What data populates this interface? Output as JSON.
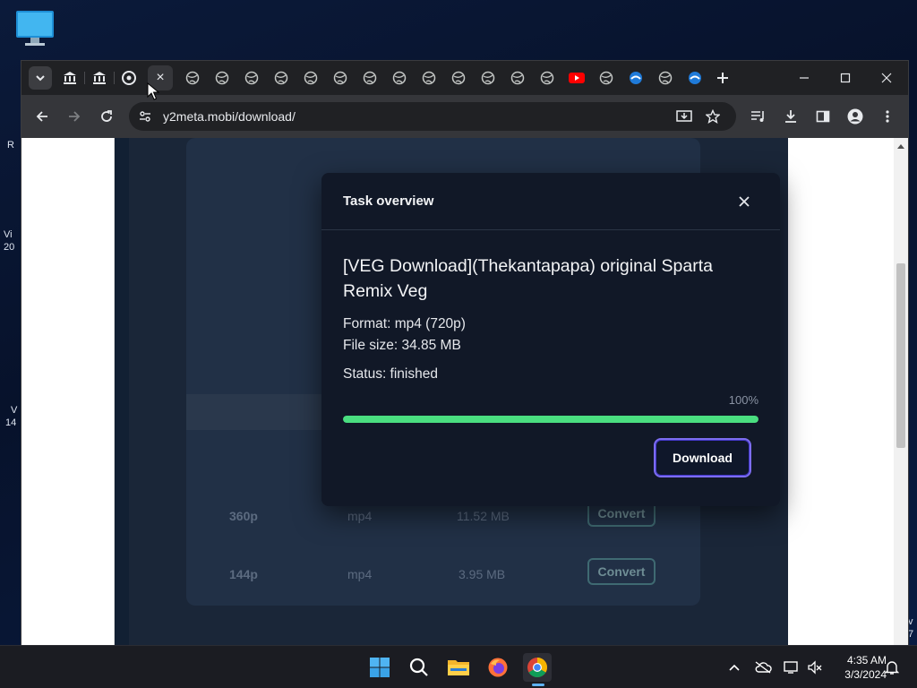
{
  "desktop": {
    "edge_labels": [
      "R",
      "Vi",
      "20",
      "V",
      "14",
      "v",
      "7"
    ]
  },
  "browser": {
    "url": "y2meta.mobi/download/",
    "active_tab_close_glyph": "×"
  },
  "site": {
    "rows": [
      {
        "quality": "360p",
        "format": "mp4",
        "size": "11.52 MB",
        "action": "Convert"
      },
      {
        "quality": "144p",
        "format": "mp4",
        "size": "3.95 MB",
        "action": "Convert"
      }
    ]
  },
  "modal": {
    "title": "Task overview",
    "video_title": "[VEG Download](Thekantapapa) original Sparta Remix Veg",
    "format_line": "Format: mp4 (720p)",
    "size_line": "File size: 34.85 MB",
    "status_line": "Status: finished",
    "progress_label": "100%",
    "progress_fraction": 1.0,
    "download_label": "Download"
  },
  "taskbar": {
    "time": "4:35 AM",
    "date": "3/3/2024"
  },
  "colors": {
    "progress": "#4ade80",
    "download_border": "#7c6cf0",
    "modal_bg": "#111827"
  }
}
